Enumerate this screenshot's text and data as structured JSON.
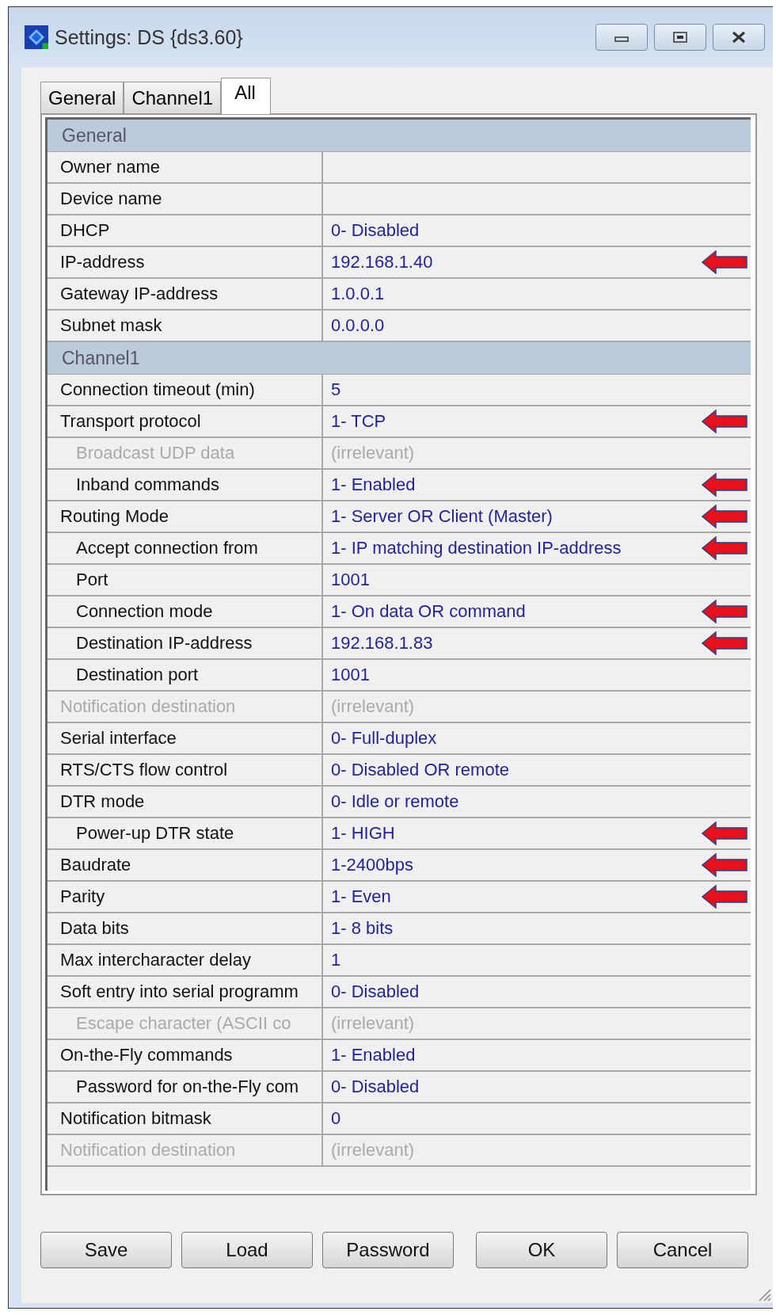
{
  "window": {
    "title": "Settings: DS {ds3.60}"
  },
  "tabs": [
    {
      "label": "General",
      "selected": false
    },
    {
      "label": "Channel1",
      "selected": false
    },
    {
      "label": "All",
      "selected": true
    }
  ],
  "rows": [
    {
      "kind": "section",
      "name": "General"
    },
    {
      "kind": "setting",
      "name": "Owner name",
      "value": "",
      "disabled": false,
      "marked": false
    },
    {
      "kind": "setting",
      "name": "Device name",
      "value": "",
      "disabled": false,
      "marked": false
    },
    {
      "kind": "setting",
      "name": "DHCP",
      "value": "0- Disabled",
      "disabled": false,
      "marked": false
    },
    {
      "kind": "setting",
      "name": "IP-address",
      "value": "192.168.1.40",
      "disabled": false,
      "marked": true
    },
    {
      "kind": "setting",
      "name": "Gateway IP-address",
      "value": "1.0.0.1",
      "disabled": false,
      "marked": false
    },
    {
      "kind": "setting",
      "name": "Subnet mask",
      "value": "0.0.0.0",
      "disabled": false,
      "marked": false
    },
    {
      "kind": "section",
      "name": "Channel1"
    },
    {
      "kind": "setting",
      "name": "Connection timeout (min)",
      "value": "5",
      "disabled": false,
      "marked": false
    },
    {
      "kind": "setting",
      "name": "Transport protocol",
      "value": "1- TCP",
      "disabled": false,
      "marked": true,
      "children": [
        {
          "kind": "setting",
          "name": "Broadcast UDP data",
          "value": "(irrelevant)",
          "disabled": true,
          "marked": false
        },
        {
          "kind": "setting",
          "name": "Inband commands",
          "value": "1- Enabled",
          "disabled": false,
          "marked": true
        }
      ]
    },
    {
      "kind": "setting",
      "name": "Routing Mode",
      "value": "1- Server OR Client (Master)",
      "disabled": false,
      "marked": true,
      "children": [
        {
          "kind": "setting",
          "name": "Accept connection from",
          "value": "1- IP matching destination IP-address",
          "disabled": false,
          "marked": true
        },
        {
          "kind": "setting",
          "name": "Port",
          "value": "1001",
          "disabled": false,
          "marked": false
        },
        {
          "kind": "setting",
          "name": "Connection mode",
          "value": "1- On data OR command",
          "disabled": false,
          "marked": true
        },
        {
          "kind": "setting",
          "name": "Destination IP-address",
          "value": "192.168.1.83",
          "disabled": false,
          "marked": true
        },
        {
          "kind": "setting",
          "name": "Destination port",
          "value": "1001",
          "disabled": false,
          "marked": false
        }
      ]
    },
    {
      "kind": "setting",
      "name": "Notification destination",
      "value": "(irrelevant)",
      "disabled": true,
      "marked": false
    },
    {
      "kind": "setting",
      "name": "Serial interface",
      "value": "0- Full-duplex",
      "disabled": false,
      "marked": false
    },
    {
      "kind": "setting",
      "name": "RTS/CTS flow control",
      "value": "0- Disabled OR remote",
      "disabled": false,
      "marked": false
    },
    {
      "kind": "setting",
      "name": "DTR mode",
      "value": "0- Idle or remote",
      "disabled": false,
      "marked": false,
      "children": [
        {
          "kind": "setting",
          "name": "Power-up DTR state",
          "value": "1- HIGH",
          "disabled": false,
          "marked": true
        }
      ]
    },
    {
      "kind": "setting",
      "name": "Baudrate",
      "value": "1-2400bps",
      "disabled": false,
      "marked": true
    },
    {
      "kind": "setting",
      "name": "Parity",
      "value": "1- Even",
      "disabled": false,
      "marked": true
    },
    {
      "kind": "setting",
      "name": "Data bits",
      "value": "1- 8 bits",
      "disabled": false,
      "marked": false
    },
    {
      "kind": "setting",
      "name": "Max intercharacter delay",
      "value": "1",
      "disabled": false,
      "marked": false
    },
    {
      "kind": "setting",
      "name": "Soft entry into serial programm",
      "value": "0- Disabled",
      "disabled": false,
      "marked": false,
      "children": [
        {
          "kind": "setting",
          "name": "Escape character (ASCII co",
          "value": "(irrelevant)",
          "disabled": true,
          "marked": false
        }
      ]
    },
    {
      "kind": "setting",
      "name": "On-the-Fly commands",
      "value": "1- Enabled",
      "disabled": false,
      "marked": false,
      "children": [
        {
          "kind": "setting",
          "name": "Password for on-the-Fly com",
          "value": "0- Disabled",
          "disabled": false,
          "marked": false
        }
      ]
    },
    {
      "kind": "setting",
      "name": "Notification bitmask",
      "value": "0",
      "disabled": false,
      "marked": false
    },
    {
      "kind": "setting",
      "name": "Notification destination",
      "value": "(irrelevant)",
      "disabled": true,
      "marked": false
    }
  ],
  "buttons": [
    "Save",
    "Load",
    "Password",
    "OK",
    "Cancel"
  ]
}
